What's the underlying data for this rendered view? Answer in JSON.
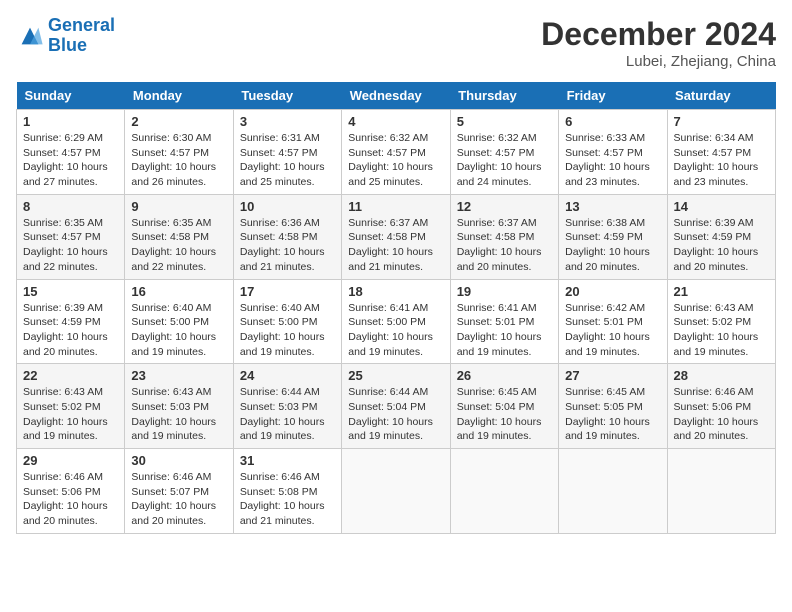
{
  "header": {
    "logo_line1": "General",
    "logo_line2": "Blue",
    "month_title": "December 2024",
    "location": "Lubei, Zhejiang, China"
  },
  "days_of_week": [
    "Sunday",
    "Monday",
    "Tuesday",
    "Wednesday",
    "Thursday",
    "Friday",
    "Saturday"
  ],
  "weeks": [
    [
      {
        "day": "1",
        "info": "Sunrise: 6:29 AM\nSunset: 4:57 PM\nDaylight: 10 hours\nand 27 minutes."
      },
      {
        "day": "2",
        "info": "Sunrise: 6:30 AM\nSunset: 4:57 PM\nDaylight: 10 hours\nand 26 minutes."
      },
      {
        "day": "3",
        "info": "Sunrise: 6:31 AM\nSunset: 4:57 PM\nDaylight: 10 hours\nand 25 minutes."
      },
      {
        "day": "4",
        "info": "Sunrise: 6:32 AM\nSunset: 4:57 PM\nDaylight: 10 hours\nand 25 minutes."
      },
      {
        "day": "5",
        "info": "Sunrise: 6:32 AM\nSunset: 4:57 PM\nDaylight: 10 hours\nand 24 minutes."
      },
      {
        "day": "6",
        "info": "Sunrise: 6:33 AM\nSunset: 4:57 PM\nDaylight: 10 hours\nand 23 minutes."
      },
      {
        "day": "7",
        "info": "Sunrise: 6:34 AM\nSunset: 4:57 PM\nDaylight: 10 hours\nand 23 minutes."
      }
    ],
    [
      {
        "day": "8",
        "info": "Sunrise: 6:35 AM\nSunset: 4:57 PM\nDaylight: 10 hours\nand 22 minutes."
      },
      {
        "day": "9",
        "info": "Sunrise: 6:35 AM\nSunset: 4:58 PM\nDaylight: 10 hours\nand 22 minutes."
      },
      {
        "day": "10",
        "info": "Sunrise: 6:36 AM\nSunset: 4:58 PM\nDaylight: 10 hours\nand 21 minutes."
      },
      {
        "day": "11",
        "info": "Sunrise: 6:37 AM\nSunset: 4:58 PM\nDaylight: 10 hours\nand 21 minutes."
      },
      {
        "day": "12",
        "info": "Sunrise: 6:37 AM\nSunset: 4:58 PM\nDaylight: 10 hours\nand 20 minutes."
      },
      {
        "day": "13",
        "info": "Sunrise: 6:38 AM\nSunset: 4:59 PM\nDaylight: 10 hours\nand 20 minutes."
      },
      {
        "day": "14",
        "info": "Sunrise: 6:39 AM\nSunset: 4:59 PM\nDaylight: 10 hours\nand 20 minutes."
      }
    ],
    [
      {
        "day": "15",
        "info": "Sunrise: 6:39 AM\nSunset: 4:59 PM\nDaylight: 10 hours\nand 20 minutes."
      },
      {
        "day": "16",
        "info": "Sunrise: 6:40 AM\nSunset: 5:00 PM\nDaylight: 10 hours\nand 19 minutes."
      },
      {
        "day": "17",
        "info": "Sunrise: 6:40 AM\nSunset: 5:00 PM\nDaylight: 10 hours\nand 19 minutes."
      },
      {
        "day": "18",
        "info": "Sunrise: 6:41 AM\nSunset: 5:00 PM\nDaylight: 10 hours\nand 19 minutes."
      },
      {
        "day": "19",
        "info": "Sunrise: 6:41 AM\nSunset: 5:01 PM\nDaylight: 10 hours\nand 19 minutes."
      },
      {
        "day": "20",
        "info": "Sunrise: 6:42 AM\nSunset: 5:01 PM\nDaylight: 10 hours\nand 19 minutes."
      },
      {
        "day": "21",
        "info": "Sunrise: 6:43 AM\nSunset: 5:02 PM\nDaylight: 10 hours\nand 19 minutes."
      }
    ],
    [
      {
        "day": "22",
        "info": "Sunrise: 6:43 AM\nSunset: 5:02 PM\nDaylight: 10 hours\nand 19 minutes."
      },
      {
        "day": "23",
        "info": "Sunrise: 6:43 AM\nSunset: 5:03 PM\nDaylight: 10 hours\nand 19 minutes."
      },
      {
        "day": "24",
        "info": "Sunrise: 6:44 AM\nSunset: 5:03 PM\nDaylight: 10 hours\nand 19 minutes."
      },
      {
        "day": "25",
        "info": "Sunrise: 6:44 AM\nSunset: 5:04 PM\nDaylight: 10 hours\nand 19 minutes."
      },
      {
        "day": "26",
        "info": "Sunrise: 6:45 AM\nSunset: 5:04 PM\nDaylight: 10 hours\nand 19 minutes."
      },
      {
        "day": "27",
        "info": "Sunrise: 6:45 AM\nSunset: 5:05 PM\nDaylight: 10 hours\nand 19 minutes."
      },
      {
        "day": "28",
        "info": "Sunrise: 6:46 AM\nSunset: 5:06 PM\nDaylight: 10 hours\nand 20 minutes."
      }
    ],
    [
      {
        "day": "29",
        "info": "Sunrise: 6:46 AM\nSunset: 5:06 PM\nDaylight: 10 hours\nand 20 minutes."
      },
      {
        "day": "30",
        "info": "Sunrise: 6:46 AM\nSunset: 5:07 PM\nDaylight: 10 hours\nand 20 minutes."
      },
      {
        "day": "31",
        "info": "Sunrise: 6:46 AM\nSunset: 5:08 PM\nDaylight: 10 hours\nand 21 minutes."
      },
      {
        "day": "",
        "info": ""
      },
      {
        "day": "",
        "info": ""
      },
      {
        "day": "",
        "info": ""
      },
      {
        "day": "",
        "info": ""
      }
    ]
  ]
}
